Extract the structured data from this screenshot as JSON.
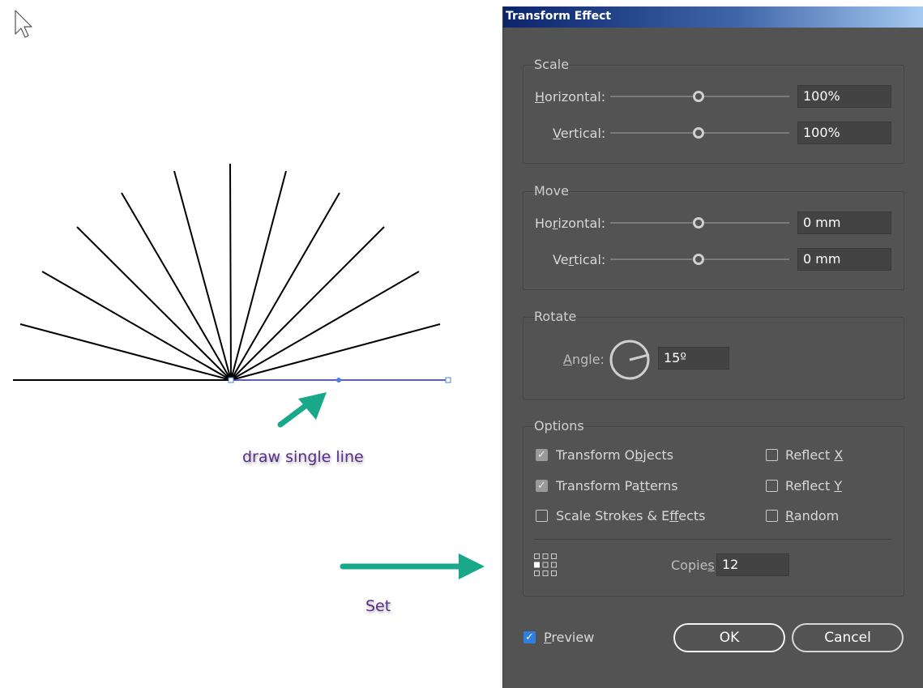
{
  "dialog": {
    "title": "Transform Effect",
    "scale": {
      "title": "Scale",
      "horizontal_label": "Horizontal:",
      "horizontal_value": "100%",
      "vertical_label": "Vertical:",
      "vertical_value": "100%"
    },
    "move": {
      "title": "Move",
      "horizontal_label": "Horizontal:",
      "horizontal_value": "0 mm",
      "vertical_label": "Vertical:",
      "vertical_value": "0 mm"
    },
    "rotate": {
      "title": "Rotate",
      "angle_label": "Angle:",
      "angle_value": "15º"
    },
    "options": {
      "title": "Options",
      "transform_objects": {
        "label": "Transform Objects",
        "checked": true
      },
      "transform_patterns": {
        "label": "Transform Patterns",
        "checked": true
      },
      "scale_strokes": {
        "label": "Scale Strokes & Effects",
        "checked": false
      },
      "reflect_x": {
        "label": "Reflect X",
        "checked": false
      },
      "reflect_y": {
        "label": "Reflect Y",
        "checked": false
      },
      "random": {
        "label": "Random",
        "checked": false
      },
      "copies_label": "Copies",
      "copies_value": "12"
    },
    "preview": {
      "label": "Preview",
      "checked": true
    },
    "ok_label": "OK",
    "cancel_label": "Cancel"
  },
  "annotations": {
    "draw_line": "draw single line",
    "set": "Set"
  },
  "colors": {
    "arrow": "#1aa88a",
    "annotation_text": "#5a2d8a",
    "dialog_bg": "#535353",
    "selection": "#4a7fe0"
  },
  "icons": {
    "cursor": "arrow-cursor-icon",
    "reference_point": "reference-point-grid-icon",
    "angle_dial": "angle-dial-icon"
  }
}
